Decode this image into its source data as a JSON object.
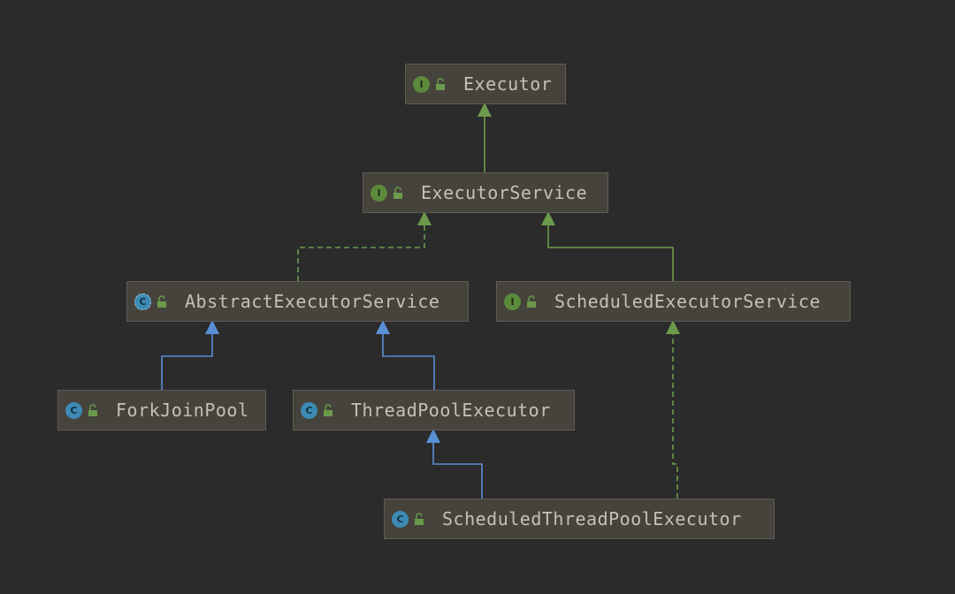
{
  "diagram": {
    "nodes": [
      {
        "id": "executor",
        "kind": "I",
        "label": "Executor"
      },
      {
        "id": "executor-service",
        "kind": "I",
        "label": "ExecutorService"
      },
      {
        "id": "abstract-executor-service",
        "kind": "AC",
        "label": "AbstractExecutorService"
      },
      {
        "id": "scheduled-executor-service",
        "kind": "I",
        "label": "ScheduledExecutorService"
      },
      {
        "id": "fork-join-pool",
        "kind": "C",
        "label": "ForkJoinPool"
      },
      {
        "id": "thread-pool-executor",
        "kind": "C",
        "label": "ThreadPoolExecutor"
      },
      {
        "id": "scheduled-thread-pool-executor",
        "kind": "C",
        "label": "ScheduledThreadPoolExecutor"
      }
    ],
    "edges": [
      {
        "from": "executor-service",
        "to": "executor",
        "type": "extends-interface"
      },
      {
        "from": "abstract-executor-service",
        "to": "executor-service",
        "type": "implements"
      },
      {
        "from": "scheduled-executor-service",
        "to": "executor-service",
        "type": "extends-interface"
      },
      {
        "from": "fork-join-pool",
        "to": "abstract-executor-service",
        "type": "extends-class"
      },
      {
        "from": "thread-pool-executor",
        "to": "abstract-executor-service",
        "type": "extends-class"
      },
      {
        "from": "scheduled-thread-pool-executor",
        "to": "thread-pool-executor",
        "type": "extends-class"
      },
      {
        "from": "scheduled-thread-pool-executor",
        "to": "scheduled-executor-service",
        "type": "implements"
      }
    ],
    "colors": {
      "background": "#2b2b2b",
      "interface_edge": "#6a9a4a",
      "class_edge": "#5a8fd6",
      "node_fill": "#45433c",
      "interface_badge": "#5c8a3b",
      "class_badge": "#3d8bb5"
    },
    "icons": {
      "I": "interface-icon",
      "C": "class-icon",
      "AC": "abstract-class-icon",
      "lock": "public-lock-icon"
    }
  }
}
